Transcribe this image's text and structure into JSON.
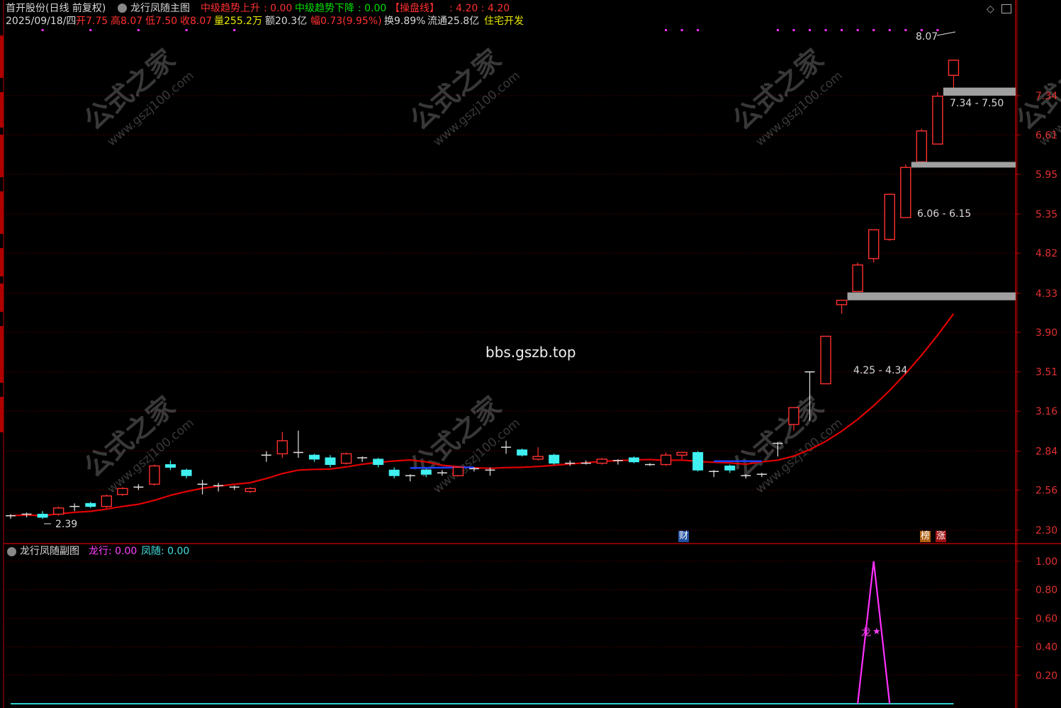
{
  "header": {
    "stock_title": "首开股份(日线 前复权)",
    "main_indicator": "龙行凤随主图",
    "trend_up_label": "中级趋势上升",
    "trend_up_value": ": 0.00",
    "trend_down_label": "中级趋势下降",
    "trend_down_value": ": 0.00",
    "op_line_label": "【操盘线】",
    "op_line_value": ": 4.20 : 4.20",
    "date": "2025/09/18/四",
    "open_label": "开",
    "open_value": "7.75",
    "high_label": "高",
    "high_value": "8.07",
    "low_label": "低",
    "low_value": "7.50",
    "close_label": "收",
    "close_value": "8.07",
    "vol_label": "量",
    "vol_value": "255.2万",
    "amt_label": "额",
    "amt_value": "20.3亿",
    "chg_label": "幅",
    "chg_value": "0.73(9.95%)",
    "turn_label": "换",
    "turn_value": "9.89%",
    "float_label": "流通",
    "float_value": "25.8亿",
    "sector": "住宅开发"
  },
  "sub_header": {
    "title": "龙行凤随副图",
    "dragon_label": "龙行: 0.00",
    "phoenix_label": "凤随: 0.00"
  },
  "watermark": {
    "site": "bbs.gszb.top",
    "stamp_cn": "公式之家",
    "stamp_url": "www.gszj100.com"
  },
  "annotations": {
    "high_price": "8.07",
    "low_price": "2.39",
    "zone1": "7.34 - 7.50",
    "zone2": "6.06 - 6.15",
    "zone3": "4.25 - 4.34",
    "badge_cai": "财",
    "badge_bang": "榜",
    "badge_zhang": "涨",
    "signal_text": "龙",
    "signal_star": "★"
  },
  "colors": {
    "up": "#ff3030",
    "down": "#40f0f0",
    "ma": "#e00000",
    "zone": "#a0a0a0",
    "dragon": "#ff30ff",
    "phoenix": "#30d0d0",
    "axis": "#b00000"
  },
  "chart_data": [
    {
      "type": "candlestick",
      "title": "龙行凤随主图",
      "y_ticks": [
        "7.34",
        "6.61",
        "5.95",
        "5.35",
        "4.82",
        "4.33",
        "3.90",
        "3.51",
        "3.16",
        "2.84",
        "2.56",
        "2.30"
      ],
      "y_scale": "log",
      "ylim": [
        2.25,
        8.3
      ],
      "candles": [
        {
          "o": 2.38,
          "h": 2.4,
          "l": 2.37,
          "c": 2.39
        },
        {
          "o": 2.39,
          "h": 2.41,
          "l": 2.38,
          "c": 2.4
        },
        {
          "o": 2.4,
          "h": 2.42,
          "l": 2.37,
          "c": 2.38
        },
        {
          "o": 2.4,
          "h": 2.45,
          "l": 2.39,
          "c": 2.44
        },
        {
          "o": 2.44,
          "h": 2.47,
          "l": 2.42,
          "c": 2.45
        },
        {
          "o": 2.47,
          "h": 2.48,
          "l": 2.44,
          "c": 2.45
        },
        {
          "o": 2.45,
          "h": 2.53,
          "l": 2.44,
          "c": 2.52
        },
        {
          "o": 2.53,
          "h": 2.58,
          "l": 2.52,
          "c": 2.57
        },
        {
          "o": 2.58,
          "h": 2.6,
          "l": 2.56,
          "c": 2.58
        },
        {
          "o": 2.6,
          "h": 2.74,
          "l": 2.59,
          "c": 2.73
        },
        {
          "o": 2.74,
          "h": 2.77,
          "l": 2.7,
          "c": 2.72
        },
        {
          "o": 2.7,
          "h": 2.71,
          "l": 2.64,
          "c": 2.66
        },
        {
          "o": 2.6,
          "h": 2.63,
          "l": 2.53,
          "c": 2.6
        },
        {
          "o": 2.59,
          "h": 2.61,
          "l": 2.55,
          "c": 2.59
        },
        {
          "o": 2.58,
          "h": 2.59,
          "l": 2.56,
          "c": 2.57
        },
        {
          "o": 2.55,
          "h": 2.58,
          "l": 2.54,
          "c": 2.57
        },
        {
          "o": 2.81,
          "h": 2.84,
          "l": 2.76,
          "c": 2.81
        },
        {
          "o": 2.82,
          "h": 2.99,
          "l": 2.79,
          "c": 2.92
        },
        {
          "o": 2.83,
          "h": 3.0,
          "l": 2.79,
          "c": 2.83
        },
        {
          "o": 2.81,
          "h": 2.82,
          "l": 2.76,
          "c": 2.78
        },
        {
          "o": 2.79,
          "h": 2.81,
          "l": 2.72,
          "c": 2.74
        },
        {
          "o": 2.75,
          "h": 2.83,
          "l": 2.74,
          "c": 2.82
        },
        {
          "o": 2.79,
          "h": 2.8,
          "l": 2.76,
          "c": 2.79
        },
        {
          "o": 2.78,
          "h": 2.79,
          "l": 2.72,
          "c": 2.74
        },
        {
          "o": 2.7,
          "h": 2.72,
          "l": 2.64,
          "c": 2.66
        },
        {
          "o": 2.66,
          "h": 2.67,
          "l": 2.62,
          "c": 2.65
        },
        {
          "o": 2.7,
          "h": 2.71,
          "l": 2.65,
          "c": 2.67
        },
        {
          "o": 2.68,
          "h": 2.7,
          "l": 2.66,
          "c": 2.67
        },
        {
          "o": 2.66,
          "h": 2.73,
          "l": 2.66,
          "c": 2.72
        },
        {
          "o": 2.71,
          "h": 2.72,
          "l": 2.69,
          "c": 2.71
        },
        {
          "o": 2.7,
          "h": 2.72,
          "l": 2.66,
          "c": 2.7
        },
        {
          "o": 2.87,
          "h": 2.92,
          "l": 2.82,
          "c": 2.87
        },
        {
          "o": 2.85,
          "h": 2.86,
          "l": 2.8,
          "c": 2.81
        },
        {
          "o": 2.78,
          "h": 2.87,
          "l": 2.77,
          "c": 2.8
        },
        {
          "o": 2.81,
          "h": 2.82,
          "l": 2.74,
          "c": 2.75
        },
        {
          "o": 2.74,
          "h": 2.77,
          "l": 2.73,
          "c": 2.75
        },
        {
          "o": 2.75,
          "h": 2.77,
          "l": 2.74,
          "c": 2.75
        },
        {
          "o": 2.75,
          "h": 2.79,
          "l": 2.74,
          "c": 2.78
        },
        {
          "o": 2.76,
          "h": 2.78,
          "l": 2.74,
          "c": 2.77
        },
        {
          "o": 2.79,
          "h": 2.8,
          "l": 2.75,
          "c": 2.76
        },
        {
          "o": 2.74,
          "h": 2.75,
          "l": 2.73,
          "c": 2.73
        },
        {
          "o": 2.74,
          "h": 2.83,
          "l": 2.73,
          "c": 2.81
        },
        {
          "o": 2.81,
          "h": 2.83,
          "l": 2.78,
          "c": 2.83
        },
        {
          "o": 2.83,
          "h": 2.84,
          "l": 2.69,
          "c": 2.7
        },
        {
          "o": 2.68,
          "h": 2.7,
          "l": 2.65,
          "c": 2.69
        },
        {
          "o": 2.73,
          "h": 2.74,
          "l": 2.68,
          "c": 2.7
        },
        {
          "o": 2.66,
          "h": 2.67,
          "l": 2.64,
          "c": 2.66
        },
        {
          "o": 2.67,
          "h": 2.68,
          "l": 2.65,
          "c": 2.66
        },
        {
          "o": 2.9,
          "h": 2.91,
          "l": 2.8,
          "c": 2.9
        },
        {
          "o": 3.05,
          "h": 3.19,
          "l": 3.0,
          "c": 3.19
        },
        {
          "o": 3.51,
          "h": 3.51,
          "l": 3.08,
          "c": 3.51
        },
        {
          "o": 3.4,
          "h": 3.86,
          "l": 3.4,
          "c": 3.86
        },
        {
          "o": 4.2,
          "h": 4.25,
          "l": 4.1,
          "c": 4.25
        },
        {
          "o": 4.35,
          "h": 4.7,
          "l": 4.35,
          "c": 4.67
        },
        {
          "o": 4.75,
          "h": 5.13,
          "l": 4.7,
          "c": 5.13
        },
        {
          "o": 5.0,
          "h": 5.65,
          "l": 4.98,
          "c": 5.64
        },
        {
          "o": 5.3,
          "h": 6.11,
          "l": 5.3,
          "c": 6.06
        },
        {
          "o": 6.15,
          "h": 6.72,
          "l": 6.15,
          "c": 6.68
        },
        {
          "o": 6.45,
          "h": 7.41,
          "l": 6.45,
          "c": 7.33
        },
        {
          "o": 7.75,
          "h": 8.07,
          "l": 7.5,
          "c": 8.07
        }
      ],
      "ma_line": "red trend line",
      "zones": [
        [
          7.34,
          7.5
        ],
        [
          6.06,
          6.15
        ],
        [
          4.25,
          4.34
        ]
      ]
    },
    {
      "type": "line",
      "title": "龙行凤随副图",
      "y_ticks": [
        "1.00",
        "0.80",
        "0.60",
        "0.40",
        "0.20"
      ],
      "ylim": [
        0,
        1.1
      ],
      "series": [
        {
          "name": "龙行",
          "peak_index": 54,
          "peak_value": 1.0
        },
        {
          "name": "凤随",
          "value": 0.0
        }
      ]
    }
  ]
}
